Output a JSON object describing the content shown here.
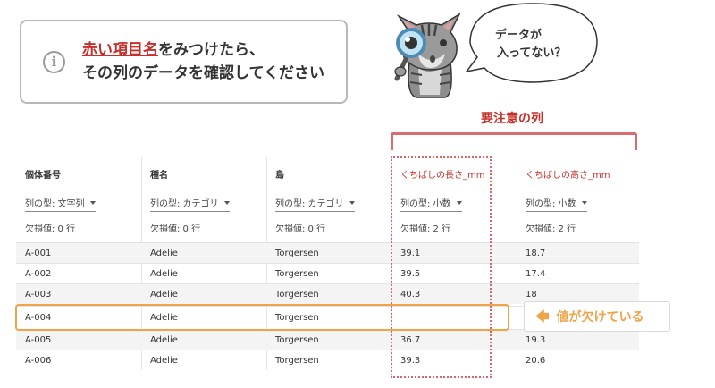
{
  "info": {
    "icon": "info-circle-icon",
    "highlight": "赤い項目名",
    "line1_rest": "をみつけたら、",
    "line2": "その列のデータを確認してください"
  },
  "bubble": {
    "line1": "データが",
    "line2": "入ってない？"
  },
  "caution": {
    "label": "要注意の列",
    "color": "#c7302a"
  },
  "table": {
    "columns": [
      {
        "name": "個体番号",
        "type": "列の型: 文字列",
        "missing": "欠損値: 0 行",
        "warn": false
      },
      {
        "name": "種名",
        "type": "列の型: カテゴリ",
        "missing": "欠損値: 0 行",
        "warn": false
      },
      {
        "name": "島",
        "type": "列の型: カテゴリ",
        "missing": "欠損値: 0 行",
        "warn": false
      },
      {
        "name": "くちばしの長さ_mm",
        "type": "列の型: 小数",
        "missing": "欠損値: 2 行",
        "warn": true
      },
      {
        "name": "くちばしの高さ_mm",
        "type": "列の型: 小数",
        "missing": "欠損値: 2 行",
        "warn": true
      }
    ],
    "rows": [
      [
        "A-001",
        "Adelie",
        "Torgersen",
        "39.1",
        "18.7"
      ],
      [
        "A-002",
        "Adelie",
        "Torgersen",
        "39.5",
        "17.4"
      ],
      [
        "A-003",
        "Adelie",
        "Torgersen",
        "40.3",
        "18"
      ],
      [
        "A-004",
        "Adelie",
        "Torgersen",
        "",
        ""
      ],
      [
        "A-005",
        "Adelie",
        "Torgersen",
        "36.7",
        "19.3"
      ],
      [
        "A-006",
        "Adelie",
        "Torgersen",
        "39.3",
        "20.6"
      ]
    ]
  },
  "callout": {
    "icon": "arrow-left-icon",
    "text": "値が欠けている",
    "color": "#f0a347"
  }
}
